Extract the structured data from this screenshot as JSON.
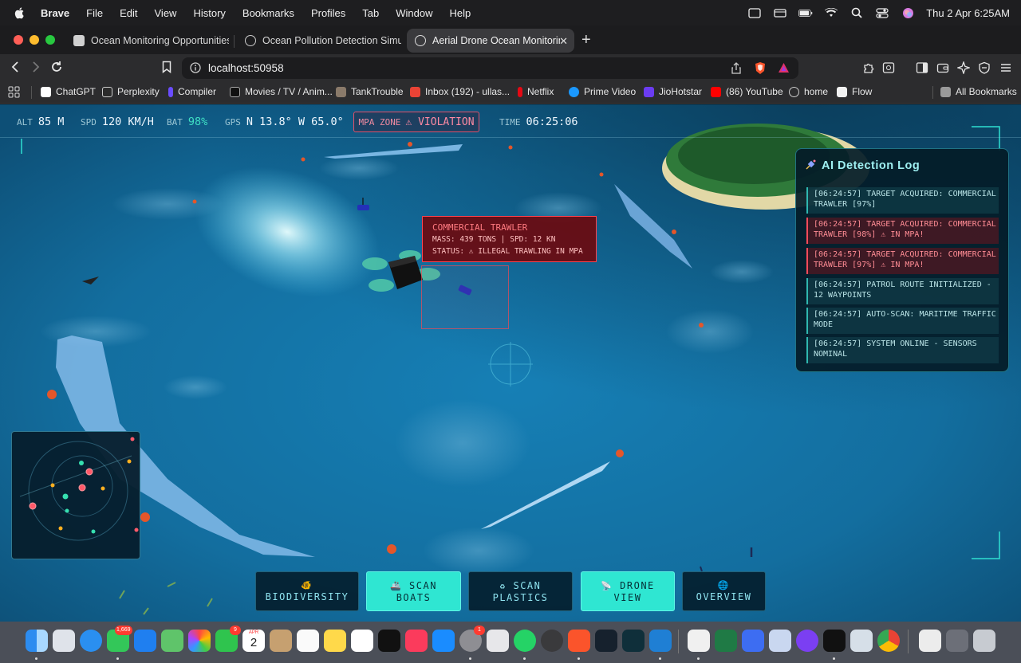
{
  "menubar": {
    "app": "Brave",
    "items": [
      "File",
      "Edit",
      "View",
      "History",
      "Bookmarks",
      "Profiles",
      "Tab",
      "Window",
      "Help"
    ],
    "clock": "Thu 2 Apr  6:25AM"
  },
  "tabs": [
    {
      "title": "Ocean Monitoring Opportunities"
    },
    {
      "title": "Ocean Pollution Detection Simulator"
    },
    {
      "title": "Aerial Drone Ocean Monitoring"
    }
  ],
  "toolbar": {
    "url": "localhost:50958"
  },
  "bookmarks": {
    "items": [
      "ChatGPT",
      "Perplexity",
      "Compiler",
      "Movies / TV / Anim...",
      "TankTrouble",
      "Inbox (192) - ullas...",
      "Netflix",
      "Prime Video",
      "JioHotstar",
      "(86) YouTube",
      "home",
      "Flow"
    ],
    "all": "All Bookmarks"
  },
  "hud": {
    "alt_label": "ALT",
    "alt_value": "85 M",
    "spd_label": "SPD",
    "spd_value": "120 KM/H",
    "bat_label": "BAT",
    "bat_value": "98%",
    "gps_label": "GPS",
    "gps_value": "N 13.8° W 65.0°",
    "mpa_label": "MPA ZONE",
    "mpa_value": "⚠ VIOLATION",
    "time_label": "TIME",
    "time_value": "06:25:06"
  },
  "target": {
    "name": "COMMERCIAL TRAWLER",
    "stats": "MASS: 439 TONS | SPD: 12 KN",
    "status": "STATUS: ⚠ ILLEGAL TRAWLING IN MPA"
  },
  "log": {
    "title": "AI Detection Log",
    "entries": [
      {
        "text": "[06:24:57] TARGET ACQUIRED: COMMERCIAL TRAWLER [97%]"
      },
      {
        "text": "[06:24:57] TARGET ACQUIRED: COMMERCIAL TRAWLER [98%] ⚠ IN MPA!"
      },
      {
        "text": "[06:24:57] TARGET ACQUIRED: COMMERCIAL TRAWLER [97%] ⚠ IN MPA!"
      },
      {
        "text": "[06:24:57] PATROL ROUTE INITIALIZED - 12 WAYPOINTS"
      },
      {
        "text": "[06:24:57] AUTO-SCAN: MARITIME TRAFFIC MODE"
      },
      {
        "text": "[06:24:57] SYSTEM ONLINE - SENSORS NOMINAL"
      }
    ]
  },
  "buttons": {
    "biodiversity": {
      "icon": "🐠",
      "line1": "BIODIVERSITY",
      "line2": ""
    },
    "scan_boats": {
      "icon": "🚢",
      "line1": "SCAN",
      "line2": "BOATS"
    },
    "scan_plastics": {
      "icon": "♻",
      "line1": "SCAN",
      "line2": "PLASTICS"
    },
    "drone_view": {
      "icon": "📡",
      "line1": "DRONE",
      "line2": "VIEW"
    },
    "overview": {
      "icon": "🌐",
      "line1": "OVERVIEW",
      "line2": ""
    }
  },
  "dock": {
    "badges": {
      "messages": "1,669",
      "facetime": "9",
      "settings": "1"
    },
    "calendar_month": "APR",
    "calendar_day": "2"
  },
  "colors": {
    "accent": "#2fe6d2",
    "alert": "#ff4a5a",
    "ocean": "#1673a5"
  }
}
